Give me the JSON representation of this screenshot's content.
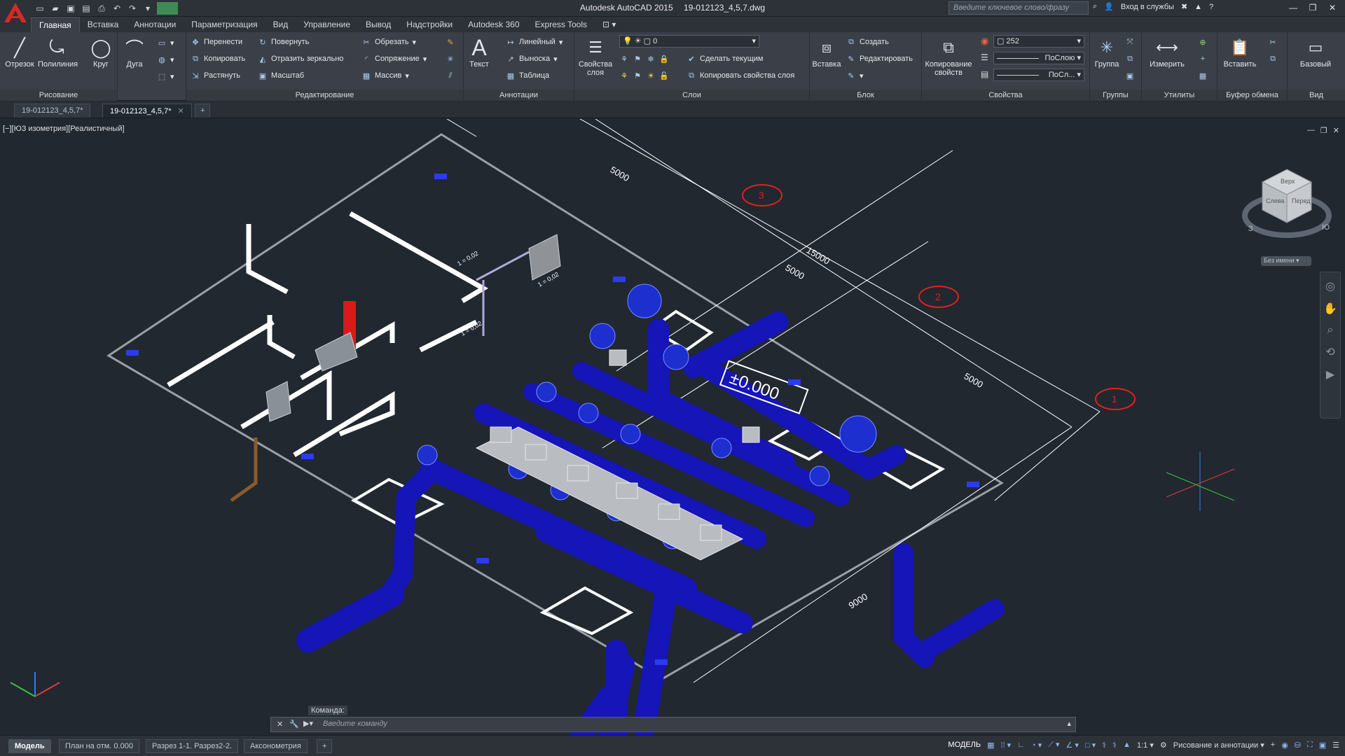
{
  "window": {
    "app_name": "Autodesk AutoCAD 2015",
    "file_name": "19-012123_4,5,7.dwg",
    "search_placeholder": "Введите ключевое слово/фразу",
    "sign_in": "Вход в службы"
  },
  "ribbon_tabs": [
    "Главная",
    "Вставка",
    "Аннотации",
    "Параметризация",
    "Вид",
    "Управление",
    "Вывод",
    "Надстройки",
    "Autodesk 360",
    "Express Tools"
  ],
  "panels": {
    "draw": {
      "title": "Рисование",
      "line": "Отрезок",
      "polyline": "Полилиния",
      "circle": "Круг",
      "arc": "Дуга"
    },
    "modify": {
      "title": "Редактирование",
      "move": "Перенести",
      "copy": "Копировать",
      "stretch": "Растянуть",
      "rotate": "Повернуть",
      "mirror": "Отразить зеркально",
      "scale": "Масштаб",
      "trim": "Обрезать",
      "fillet": "Сопряжение",
      "array": "Массив"
    },
    "annotation": {
      "title": "Аннотации",
      "text": "Текст",
      "linear": "Линейный",
      "leader": "Выноска",
      "table": "Таблица"
    },
    "layers": {
      "title": "Слои",
      "props": "Свойства слоя",
      "layer_value": "0",
      "make_current": "Сделать текущим",
      "match_layer": "Копировать свойства слоя"
    },
    "block": {
      "title": "Блок",
      "insert": "Вставка",
      "create": "Создать",
      "edit": "Редактировать"
    },
    "properties": {
      "title": "Свойства",
      "match": "Копирование свойств",
      "color": "252",
      "linetype": "ПоСлою",
      "lineweight": "ПоСл..."
    },
    "groups": {
      "title": "Группы",
      "group": "Группа"
    },
    "utilities": {
      "title": "Утилиты",
      "measure": "Измерить"
    },
    "clipboard": {
      "title": "Буфер обмена",
      "paste": "Вставить"
    },
    "view": {
      "title": "Вид",
      "base": "Базовый"
    }
  },
  "doc_tabs": [
    "19-012123_4,5,7*",
    "19-012123_4,5,7*"
  ],
  "viewport": {
    "label": "[−][ЮЗ изометрия][Реалистичный]",
    "level": "±0.000",
    "dims": [
      "5000",
      "15000",
      "5000",
      "5000",
      "9000"
    ],
    "axes": [
      "3",
      "2",
      "1"
    ],
    "pipe_labels": [
      "1 = 0,02",
      "1 = 0,02",
      "1 = 0,02"
    ],
    "viewcube": {
      "top": "Верх",
      "left": "Слева",
      "front": "Перед",
      "compass": [
        "З",
        "Ю"
      ],
      "wcs": "Без имени"
    }
  },
  "command": {
    "label": "Команда:",
    "placeholder": "Введите команду"
  },
  "layout_tabs": [
    "Модель",
    "План на отм. 0.000",
    "Разрез 1-1. Разрез2-2.",
    "Аксонометрия"
  ],
  "status": {
    "model": "МОДЕЛЬ",
    "scale": "1:1",
    "workspace": "Рисование и аннотации"
  }
}
